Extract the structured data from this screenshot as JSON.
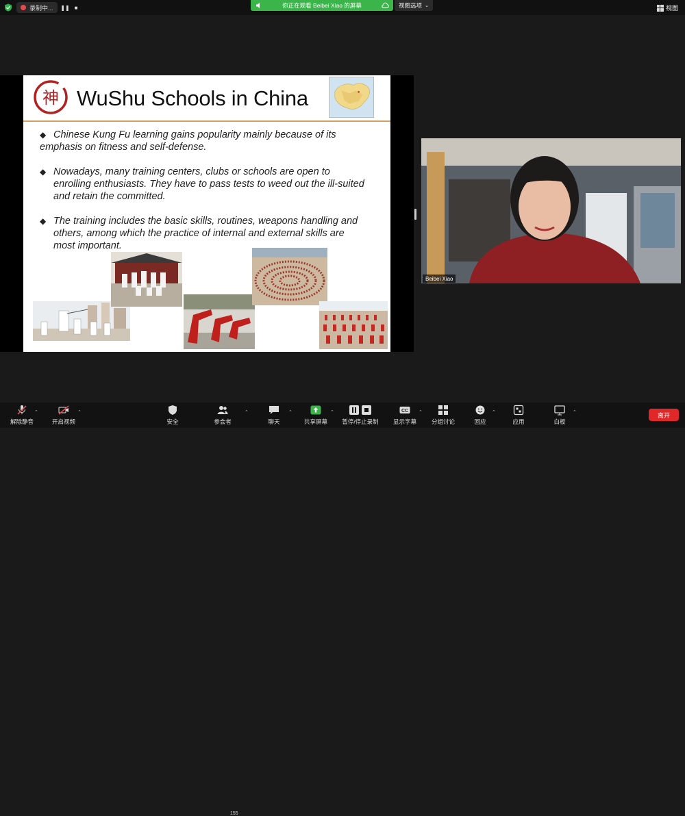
{
  "top_bar": {
    "recording_label": "录制中...",
    "watching_banner": "你正在观看 Beibei Xiao 的屏幕",
    "view_options_label": "视图选项",
    "view_label": "视图",
    "banner_color": "#3bb54a"
  },
  "slide": {
    "logo_char": "神",
    "title": "WuShu Schools in China",
    "bullets": [
      "Chinese Kung Fu learning gains popularity mainly because of its emphasis on fitness and self-defense.",
      "Nowadays, many training centers, clubs or schools are open to enrolling enthusiasts. They have to pass tests to weed out the ill-suited and retain the committed.",
      "The training includes the basic skills, routines, weapons handling and others, among which the practice of internal and external skills are most important."
    ],
    "bullet_marker": "◆"
  },
  "participant": {
    "name": "Beibei Xiao"
  },
  "toolbar": {
    "unmute": "解除静音",
    "start_video": "开启视频",
    "security": "安全",
    "participants": "参会者",
    "participants_count": "155",
    "chat": "聊天",
    "share_screen": "共享屏幕",
    "pause_stop_recording": "暂停/停止录制",
    "captions": "显示字幕",
    "captions_icon_text": "CC",
    "breakout": "分组讨论",
    "reactions": "回应",
    "apps": "应用",
    "whiteboard": "白板",
    "leave": "离开",
    "leave_color": "#e02828",
    "share_color": "#3bb54a"
  }
}
